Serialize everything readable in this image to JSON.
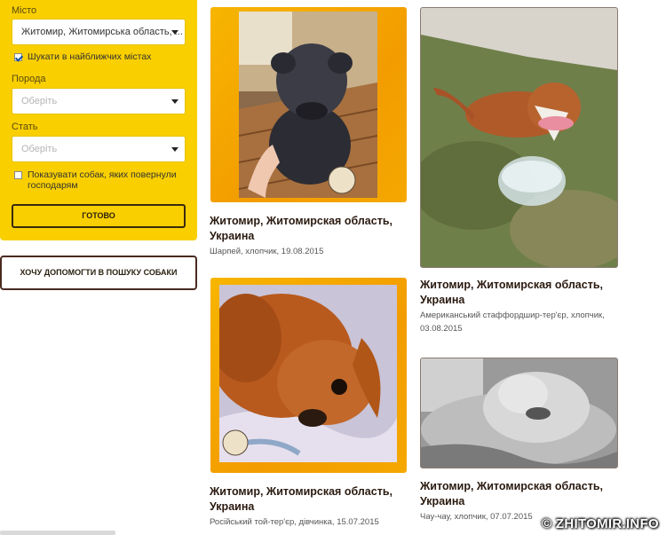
{
  "filters": {
    "city_label": "Місто",
    "city_value": "Житомир, Житомирська область, ...",
    "nearby_label": "Шукати в найближчих містах",
    "nearby_checked": true,
    "breed_label": "Порода",
    "breed_placeholder": "Оберіть",
    "sex_label": "Стать",
    "sex_placeholder": "Оберіть",
    "returned_label": "Показувати собак, яких повернули господарям",
    "returned_checked": false,
    "done_button": "ГОТОВО",
    "accent_color": "#f9cf00"
  },
  "help_button": "ХОЧУ ДОПОМОГТИ В ПОШУКУ СОБАКИ",
  "cards": [
    {
      "title": "Житомир, Житомирская область, Украина",
      "meta": "Шарпей, хлопчик, 19.08.2015",
      "photo_icon": "dog-photo-sharpei"
    },
    {
      "title": "Житомир, Житомирская область, Украина",
      "meta": "Американський стаффордшир-тер'єр, хлопчик, 03.08.2015",
      "photo_icon": "dog-photo-staffordshire"
    },
    {
      "title": "Житомир, Житомирская область, Украина",
      "meta": "Російський той-тер'єр, дівчинка, 15.07.2015",
      "photo_icon": "dog-photo-toy-terrier"
    },
    {
      "title": "Житомир, Житомирская область, Украина",
      "meta": "Чау-чау, хлопчик, 07.07.2015",
      "photo_icon": "dog-photo-chow-chow"
    }
  ],
  "watermark": "© ZHITOMIR.INFO"
}
